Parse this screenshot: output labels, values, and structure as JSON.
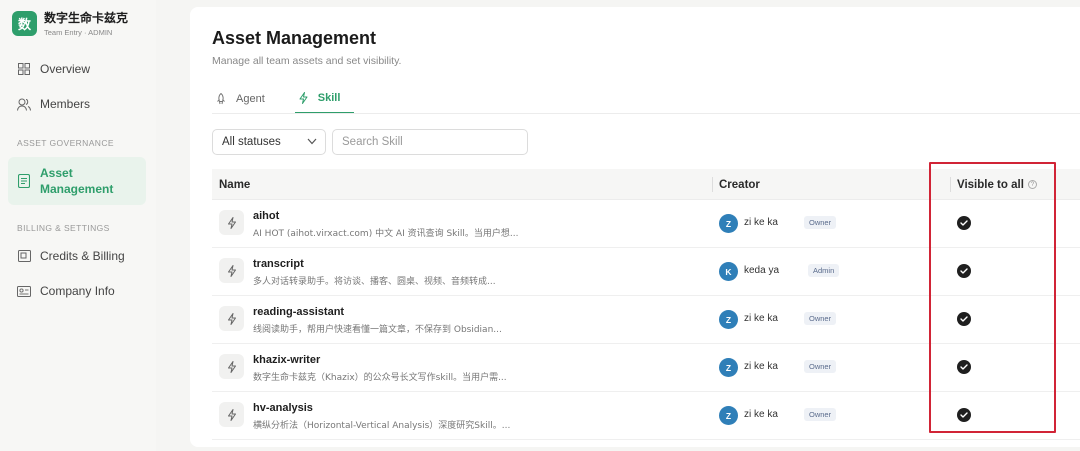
{
  "brand": {
    "logo_char": "数",
    "name": "数字生命卡兹克",
    "subtitle": "Team Entry · ADMIN"
  },
  "sidebar": {
    "items": [
      {
        "label": "Overview",
        "icon": "grid-icon"
      },
      {
        "label": "Members",
        "icon": "members-icon"
      }
    ],
    "section_asset": "ASSET GOVERNANCE",
    "asset_item": {
      "label": "Asset Management",
      "icon": "document-icon"
    },
    "section_billing": "BILLING & SETTINGS",
    "billing_items": [
      {
        "label": "Credits & Billing",
        "icon": "wallet-icon"
      },
      {
        "label": "Company Info",
        "icon": "id-card-icon"
      }
    ]
  },
  "main": {
    "title": "Asset Management",
    "subtitle": "Manage all team assets and set visibility.",
    "tabs": [
      {
        "label": "Agent",
        "icon": "rocket-icon",
        "active": false
      },
      {
        "label": "Skill",
        "icon": "lightning-icon",
        "active": true
      }
    ],
    "filter": {
      "selected": "All statuses"
    },
    "search": {
      "placeholder": "Search Skill"
    }
  },
  "table": {
    "headers": {
      "name": "Name",
      "creator": "Creator",
      "visible": "Visible to all"
    },
    "rows": [
      {
        "name": "aihot",
        "desc": "AI HOT (aihot.virxact.com) 中文 AI 资讯查询 Skill。当用户想...",
        "avatar": "Z",
        "creator": "zi ke ka",
        "role": "Owner",
        "visible": true
      },
      {
        "name": "transcript",
        "desc": "多人对话转录助手。将访谈、播客、圆桌、视频、音频转成...",
        "avatar": "K",
        "creator": "keda ya",
        "role": "Admin",
        "visible": true
      },
      {
        "name": "reading-assistant",
        "desc": "线阅读助手，帮用户快速看懂一篇文章，不保存到 Obsidian...",
        "avatar": "Z",
        "creator": "zi ke ka",
        "role": "Owner",
        "visible": true
      },
      {
        "name": "khazix-writer",
        "desc": "数字生命卡兹克（Khazix）的公众号长文写作skill。当用户需...",
        "avatar": "Z",
        "creator": "zi ke ka",
        "role": "Owner",
        "visible": true
      },
      {
        "name": "hv-analysis",
        "desc": "横纵分析法（Horizontal-Vertical Analysis）深度研究Skill。...",
        "avatar": "Z",
        "creator": "zi ke ka",
        "role": "Owner",
        "visible": true
      }
    ]
  },
  "colors": {
    "accent": "#2e9e6b",
    "highlight": "#d12436",
    "avatar": "#2f7fb8"
  }
}
